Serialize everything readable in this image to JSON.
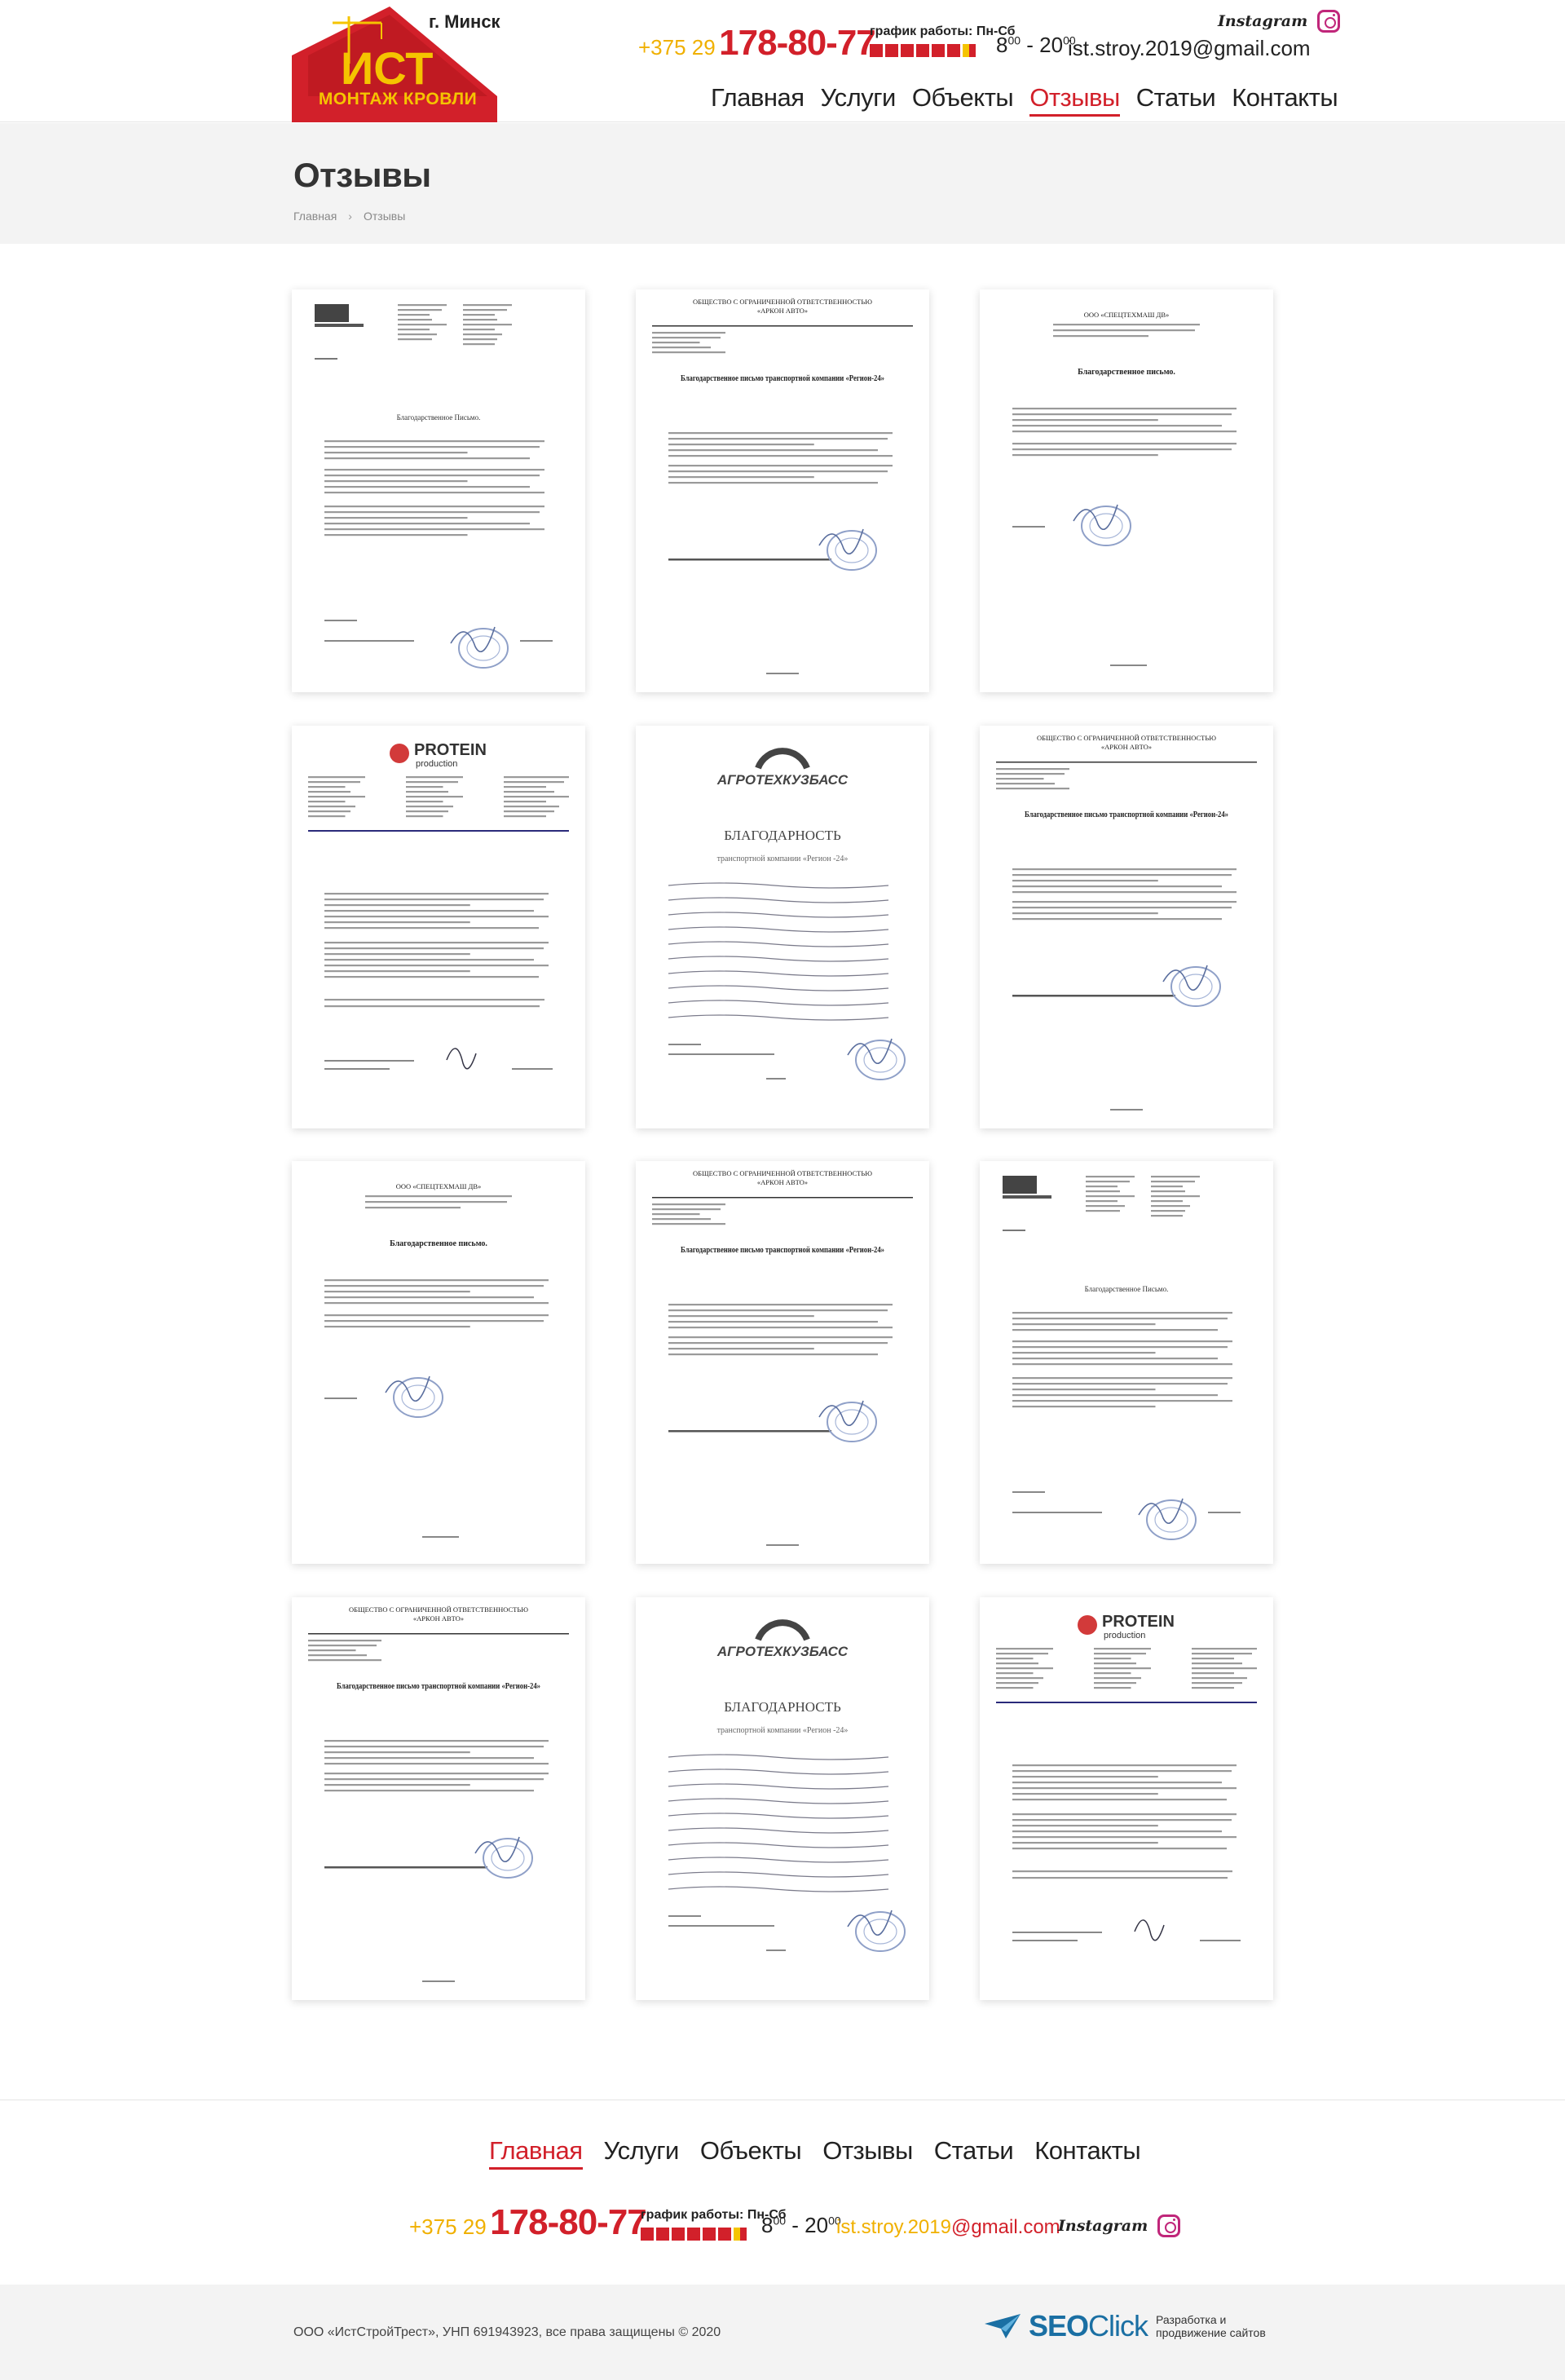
{
  "brand": {
    "logo_letters": "ИСТ",
    "logo_title": "МОНТАЖ КРОВЛИ",
    "city": "г. Минск"
  },
  "contacts": {
    "phone_prefix": "+375 29",
    "phone_main": "178-80-77",
    "schedule_label": "график работы: Пн-Сб",
    "hours_from": "8",
    "hours_from_sup": "00",
    "hours_dash": " - ",
    "hours_to": "20",
    "hours_to_sup": "00",
    "email": "ist.stroy.2019@gmail.com",
    "email_user": "ist.stroy.2019",
    "email_domain": "@gmail.com",
    "instagram_label": "Instagram"
  },
  "nav": {
    "items": [
      {
        "label": "Главная"
      },
      {
        "label": "Услуги"
      },
      {
        "label": "Объекты"
      },
      {
        "label": "Отзывы"
      },
      {
        "label": "Статьи"
      },
      {
        "label": "Контакты"
      }
    ],
    "active_header": "Отзывы",
    "active_footer": "Главная"
  },
  "page": {
    "title": "Отзывы",
    "breadcrumb": [
      "Главная",
      "Отзывы"
    ]
  },
  "reviews": [
    {
      "type": "letter-lilia",
      "heading": "Благодарственное Письмо."
    },
    {
      "type": "letter-arkon",
      "org": "ОБЩЕСТВО С ОГРАНИЧЕННОЙ ОТВЕТСТВЕННОСТЬЮ",
      "name": "«АРКОН АВТО»",
      "heading": "Благодарственное письмо транспортной компании «Регион-24»"
    },
    {
      "type": "letter-spets",
      "org": "ООО «СПЕЦТЕХМАШ ДВ»",
      "heading": "Благодарственное письмо."
    },
    {
      "type": "letter-protein",
      "brand": "PROTEIN",
      "sub": "production"
    },
    {
      "type": "letter-agro",
      "brand": "АГРОТЕХКУЗБАСС",
      "heading": "БЛАГОДАРНОСТЬ",
      "sub": "транспортной компании «Регион -24»"
    },
    {
      "type": "letter-arkon",
      "org": "ОБЩЕСТВО С ОГРАНИЧЕННОЙ ОТВЕТСТВЕННОСТЬЮ",
      "name": "«АРКОН АВТО»",
      "heading": "Благодарственное письмо транспортной компании «Регион-24»"
    },
    {
      "type": "letter-spets",
      "org": "ООО «СПЕЦТЕХМАШ ДВ»",
      "heading": "Благодарственное письмо."
    },
    {
      "type": "letter-arkon",
      "org": "ОБЩЕСТВО С ОГРАНИЧЕННОЙ ОТВЕТСТВЕННОСТЬЮ",
      "name": "«АРКОН АВТО»",
      "heading": "Благодарственное письмо транспортной компании «Регион-24»"
    },
    {
      "type": "letter-lilia",
      "heading": "Благодарственное Письмо."
    },
    {
      "type": "letter-arkon",
      "org": "ОБЩЕСТВО С ОГРАНИЧЕННОЙ ОТВЕТСТВЕННОСТЬЮ",
      "name": "«АРКОН АВТО»",
      "heading": "Благодарственное письмо транспортной компании «Регион-24»"
    },
    {
      "type": "letter-agro",
      "brand": "АГРОТЕХКУЗБАСС",
      "heading": "БЛАГОДАРНОСТЬ",
      "sub": "транспортной компании «Регион -24»"
    },
    {
      "type": "letter-protein",
      "brand": "PROTEIN",
      "sub": "production"
    }
  ],
  "footer": {
    "copyright": "ООО «ИстСтройТрест», УНП 691943923, все права защищены © 2020",
    "dev_logo_a": "SEO",
    "dev_logo_b": "Click",
    "dev_tagline": "Разработка и продвижение сайтов"
  },
  "colors": {
    "accent_red": "#d2202a",
    "accent_yellow": "#f5c400",
    "band_gray": "#f3f3f3"
  },
  "icons": [
    "instagram-icon",
    "seoclick-logo-icon",
    "breadcrumb-chevron-icon"
  ]
}
